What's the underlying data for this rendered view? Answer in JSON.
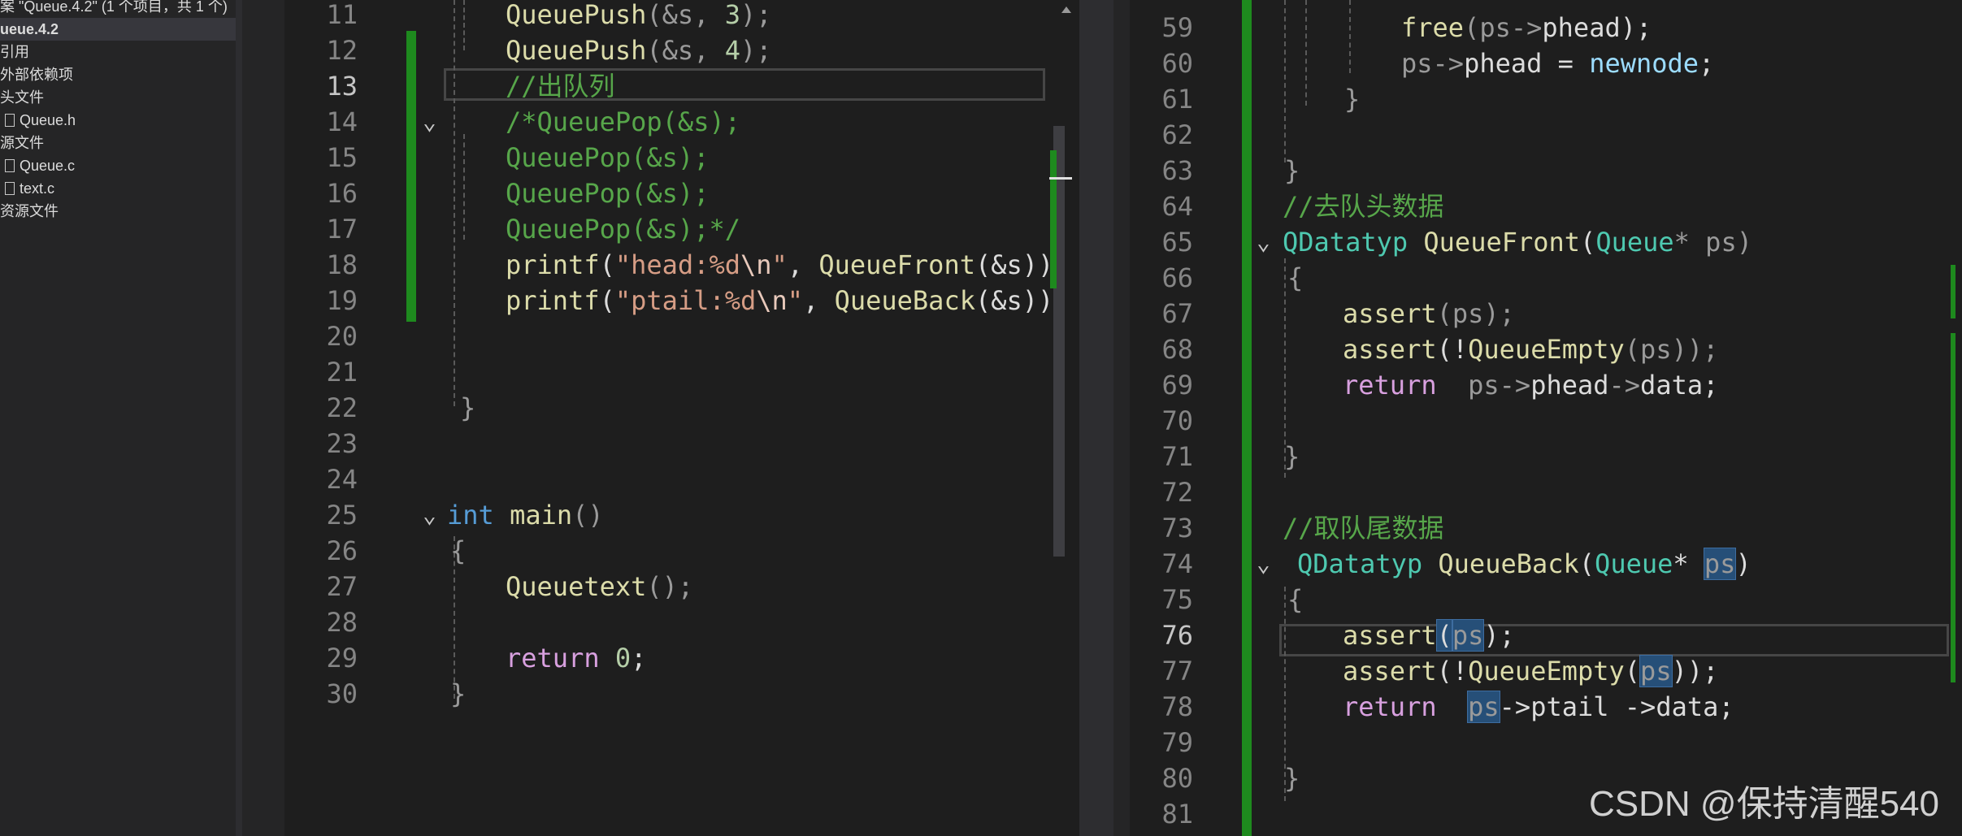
{
  "solution_explorer": {
    "title": "案 \"Queue.4.2\" (1 个项目，共 1 个)",
    "project": "ueue.4.2",
    "items": [
      {
        "label": "引用"
      },
      {
        "label": "外部依赖项"
      },
      {
        "label": "头文件"
      },
      {
        "label": "Queue.h",
        "file": true
      },
      {
        "label": "源文件"
      },
      {
        "label": "Queue.c",
        "file": true
      },
      {
        "label": "text.c",
        "file": true
      },
      {
        "label": "资源文件"
      }
    ]
  },
  "left_editor": {
    "line_numbers": [
      "11",
      "12",
      "13",
      "14",
      "15",
      "16",
      "17",
      "18",
      "19",
      "20",
      "21",
      "22",
      "23",
      "24",
      "25",
      "26",
      "27",
      "28",
      "29",
      "30"
    ],
    "current_line": "13"
  },
  "right_editor": {
    "line_numbers": [
      "59",
      "60",
      "61",
      "62",
      "63",
      "64",
      "65",
      "66",
      "67",
      "68",
      "69",
      "70",
      "71",
      "72",
      "73",
      "74",
      "75",
      "76",
      "77",
      "78",
      "79",
      "80",
      "81"
    ],
    "current_line": "76"
  },
  "left_code": {
    "l11a": "QueuePush",
    "l11b": "(&s, ",
    "l11c": "3",
    "l11d": ");",
    "l12a": "QueuePush",
    "l12b": "(&s, ",
    "l12c": "4",
    "l12d": ");",
    "l13": "//出队列",
    "l14": "/*QueuePop(&s);",
    "l15": "QueuePop(&s);",
    "l16": "QueuePop(&s);",
    "l17": "QueuePop(&s);*/",
    "l18a": "printf",
    "l18b": "(",
    "l18c": "\"head:%d",
    "l18d": "\\n",
    "l18e": "\"",
    "l18f": ", ",
    "l18g": "QueueFront",
    "l18h": "(&s));",
    "l19a": "printf",
    "l19b": "(",
    "l19c": "\"ptail:%d",
    "l19d": "\\n",
    "l19e": "\"",
    "l19f": ", ",
    "l19g": "QueueBack",
    "l19h": "(&s));",
    "l22": "}",
    "l25a": "int",
    "l25b": " main",
    "l25c": "()",
    "l26": "{",
    "l27a": "Queuetext",
    "l27b": "();",
    "l29a": "return",
    "l29b": " 0",
    "l29c": ";",
    "l30": "}"
  },
  "right_code": {
    "l59a": "free",
    "l59b": "(ps->",
    "l59c": "phead",
    "l59d": ");",
    "l60a": "ps->",
    "l60b": "phead",
    "l60c": " = ",
    "l60d": "newnode",
    "l60e": ";",
    "l61": "}",
    "l63": "}",
    "l64": "//去队头数据",
    "l65a": "QDatatyp",
    "l65b": " QueueFront",
    "l65c": "(",
    "l65d": "Queue",
    "l65e": "* ps)",
    "l66": "{",
    "l67a": "assert",
    "l67b": "(ps);",
    "l68a": "assert",
    "l68b": "(!",
    "l68c": "QueueEmpty",
    "l68d": "(ps));",
    "l69a": "return",
    "l69b": "  ps->",
    "l69c": "phead",
    "l69d": "->",
    "l69e": "data",
    ";": ";",
    "l71": "}",
    "l73": "//取队尾数据",
    "l74a": "QDatatyp",
    "l74b": " QueueBack",
    "l74c": "(",
    "l74d": "Queue",
    "l74e": "* ",
    "l74f": "ps",
    "l74g": ")",
    "l75": "{",
    "l76a": "assert",
    "l76b": "(",
    "l76c": "ps",
    "l76d": ");",
    "l77a": "assert",
    "l77b": "(!",
    "l77c": "QueueEmpty",
    "l77d": "(",
    "l77e": "ps",
    "l77f": "));",
    "l78a": "return",
    "l78b": "  ",
    "l78c": "ps",
    "l78d": "->ptail ->data;",
    "l80": "}"
  },
  "watermark": "CSDN @保持清醒540",
  "colors": {
    "background": "#1e1e1e",
    "keyword": "#569cd6",
    "function": "#dcdcaa",
    "comment": "#57a64a",
    "type": "#4ec9b0",
    "string": "#d69d85",
    "change_bar": "#1e8a1e"
  }
}
